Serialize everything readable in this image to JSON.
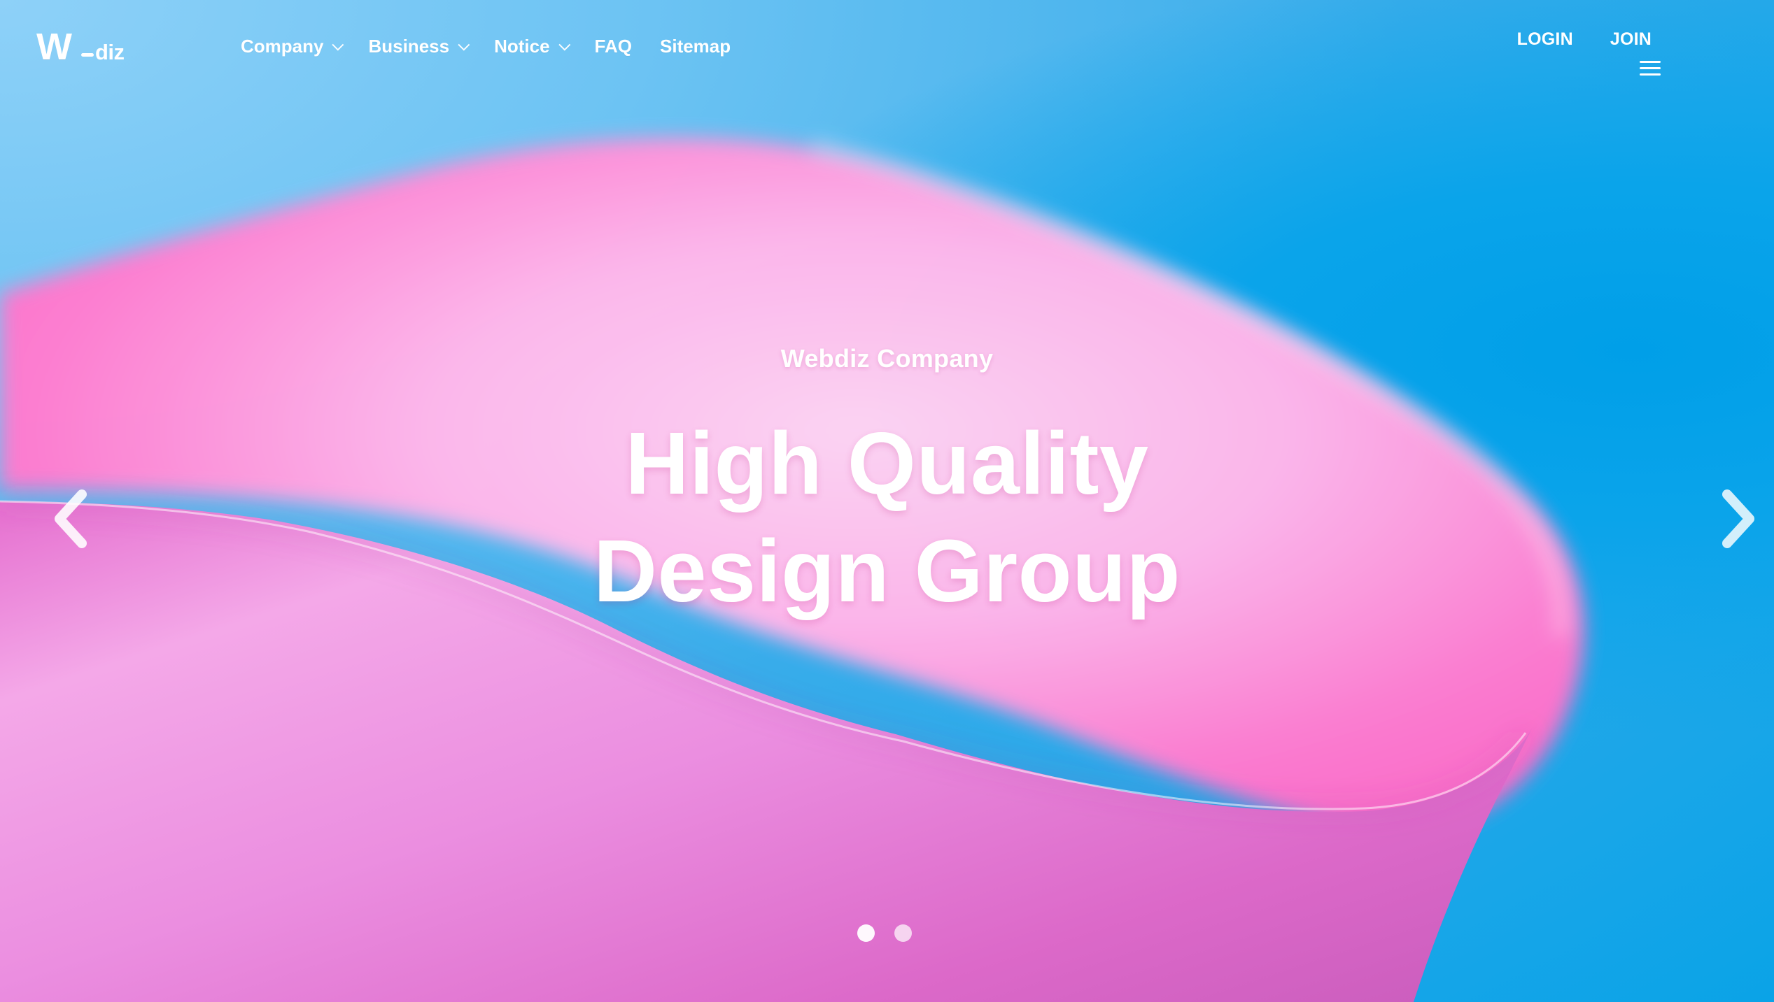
{
  "brand": {
    "logo_main": "W",
    "logo_suffix": "diz"
  },
  "header": {
    "nav_items": [
      {
        "label": "Company",
        "has_dropdown": true
      },
      {
        "label": "Business",
        "has_dropdown": true
      },
      {
        "label": "Notice",
        "has_dropdown": true
      },
      {
        "label": "FAQ",
        "has_dropdown": false
      },
      {
        "label": "Sitemap",
        "has_dropdown": false
      }
    ],
    "auth": {
      "login": "LOGIN",
      "join": "JOIN"
    },
    "menu_icon": "hamburger-menu-icon"
  },
  "hero": {
    "subtitle": "Webdiz Company",
    "headline_line_1": "High Quality",
    "headline_line_2": "Design Group",
    "colors": {
      "sky": "#0aa3e7",
      "pink": "#ff6ccf",
      "pink_light": "#f4b8ee",
      "white": "#ffffff"
    }
  },
  "carousel": {
    "left_arrow": "chevron-left-icon",
    "right_arrow": "chevron-right-icon",
    "dots": [
      {
        "state": "active"
      },
      {
        "state": "inactive"
      }
    ]
  }
}
